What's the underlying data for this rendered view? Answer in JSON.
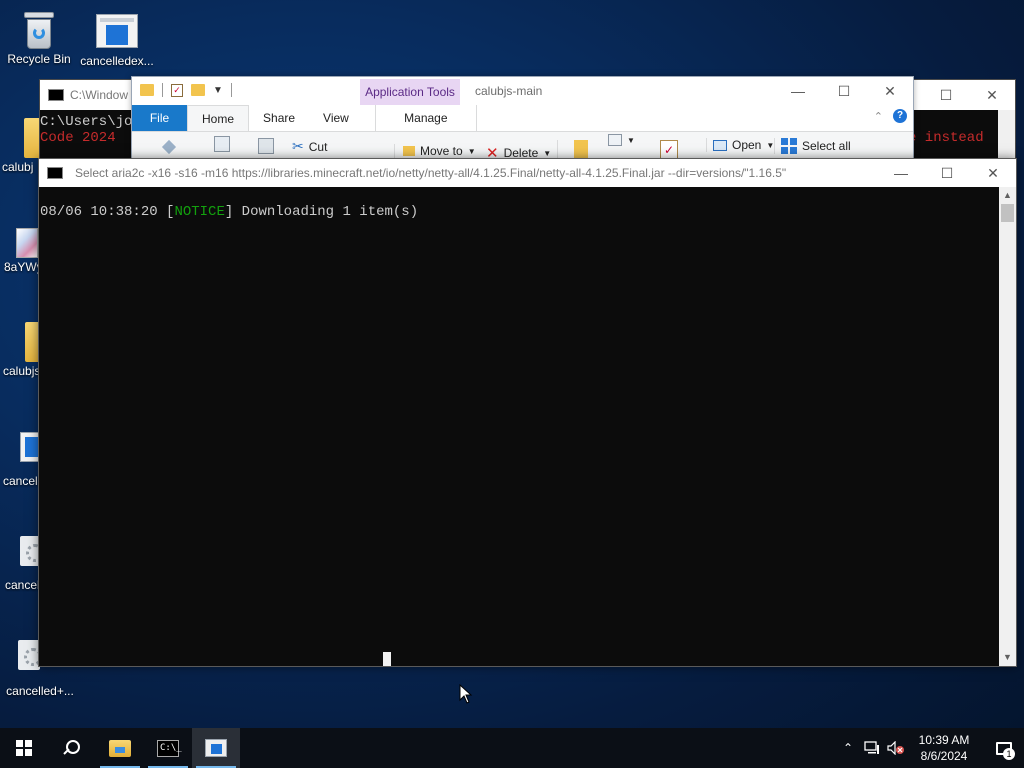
{
  "desktop": {
    "icons": [
      {
        "label": "Recycle Bin",
        "icon": "recycle-bin-icon"
      },
      {
        "label": "cancelledex...",
        "icon": "document-window-icon"
      },
      {
        "label": "calubj",
        "icon": "folder-icon"
      },
      {
        "label": "8aYWy",
        "icon": "image-file-icon"
      },
      {
        "label": "calubjs",
        "icon": "folder-icon"
      },
      {
        "label": "cancell",
        "icon": "document-window-icon"
      },
      {
        "label": "cancell",
        "icon": "settings-file-icon"
      },
      {
        "label": "cancelled+...",
        "icon": "settings-file-icon"
      }
    ]
  },
  "cmd_back": {
    "title": "C:\\Window",
    "line1": "C:\\Users\\jo",
    "line2_left": "Code 2024",
    "line2_right": "e instead"
  },
  "explorer": {
    "context_tab": "Application Tools",
    "title": "calubjs-main",
    "tabs": {
      "file": "File",
      "home": "Home",
      "share": "Share",
      "view": "View",
      "manage": "Manage"
    },
    "ribbon": {
      "cut": "Cut",
      "move_to": "Move to",
      "delete": "Delete",
      "open": "Open",
      "select_all": "Select all"
    }
  },
  "cmd_front": {
    "title": "Select aria2c  -x16 -s16 -m16 https://libraries.minecraft.net/io/netty/netty-all/4.1.25.Final/netty-all-4.1.25.Final.jar --dir=versions/\"1.16.5\"",
    "log": {
      "timestamp": "08/06 10:38:20",
      "bracket_open": "[",
      "level": "NOTICE",
      "bracket_close": "]",
      "message": "Downloading 1 item(s)"
    }
  },
  "taskbar": {
    "apps": [
      "start-button",
      "search-button",
      "file-explorer",
      "command-prompt",
      "application-window"
    ],
    "cmd_glyph": "C:\\_",
    "clock_time": "10:39 AM",
    "clock_date": "8/6/2024",
    "notification_count": "1"
  },
  "colors": {
    "console_bg": "#0c0c0c",
    "console_text": "#cccccc",
    "notice_green": "#13a10e",
    "file_tab_blue": "#1979ca",
    "context_tab_purple": "#e8d6f3"
  }
}
